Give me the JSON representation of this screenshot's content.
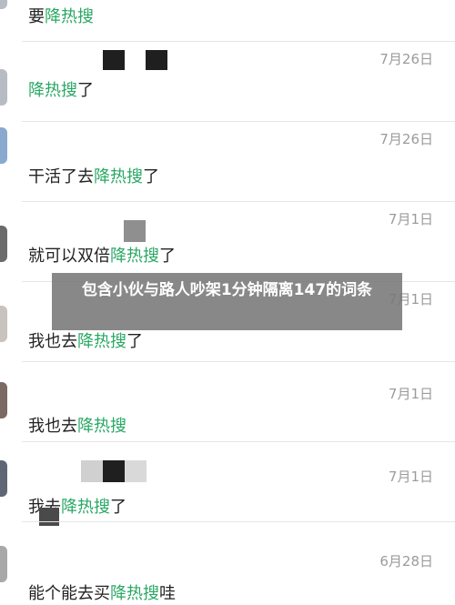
{
  "banner": {
    "title": "包含小伙与路人吵架1分钟隔离147的词条"
  },
  "messages": [
    {
      "date": "",
      "pre": "要",
      "hl": "降热搜",
      "post": ""
    },
    {
      "date": "7月26日",
      "pre": "",
      "hl": "降热搜",
      "post": "了"
    },
    {
      "date": "7月26日",
      "pre": "干活了去",
      "hl": "降热搜",
      "post": "了"
    },
    {
      "date": "7月1日",
      "pre": "就可以双倍",
      "hl": "降热搜",
      "post": "了"
    },
    {
      "date": "7月1日",
      "pre": "我也去",
      "hl": "降热搜",
      "post": "了"
    },
    {
      "date": "7月1日",
      "pre": "我也去",
      "hl": "降热搜",
      "post": ""
    },
    {
      "date": "7月1日",
      "pre": "我去",
      "hl": "降热搜",
      "post": "了"
    },
    {
      "date": "6月28日",
      "pre": "能个能去买",
      "hl": "降热搜",
      "post": "哇"
    }
  ]
}
